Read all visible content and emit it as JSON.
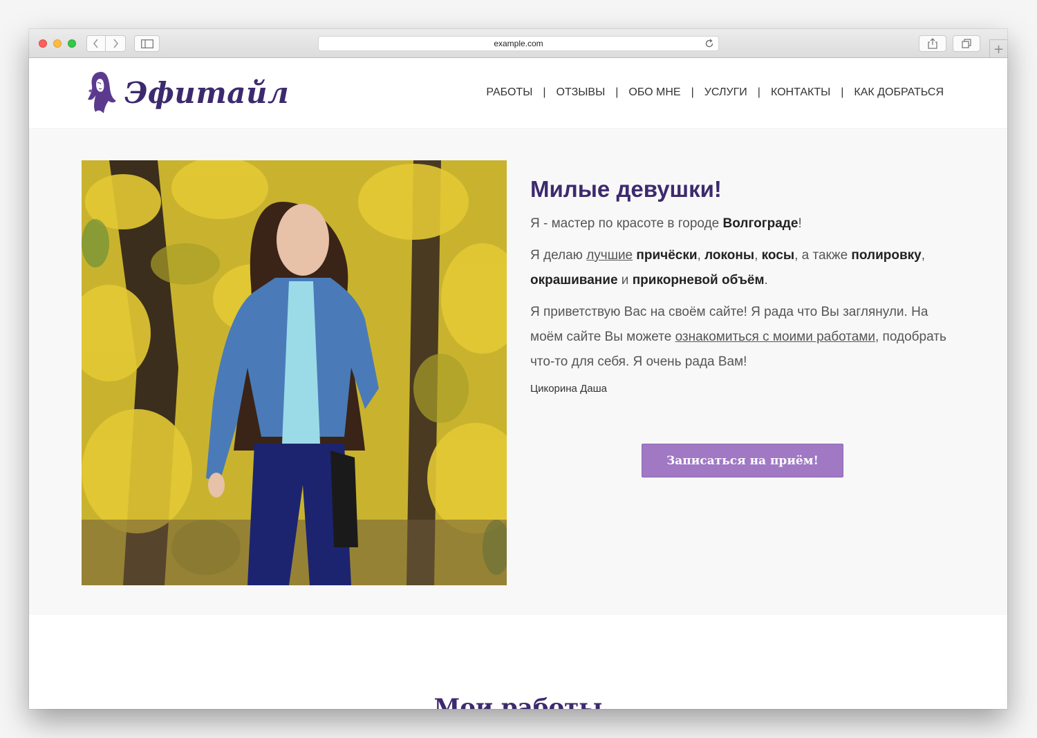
{
  "browser": {
    "url": "example.com",
    "icons": {
      "back": "chevron-left-icon",
      "forward": "chevron-right-icon",
      "sidebar": "sidebar-icon",
      "reload": "reload-icon",
      "share": "share-icon",
      "tabs": "tabs-icon",
      "new_tab": "plus-icon"
    }
  },
  "header": {
    "logo_text": "Эфитайл",
    "nav": [
      {
        "label": "РАБОТЫ"
      },
      {
        "label": "ОТЗЫВЫ"
      },
      {
        "label": "ОБО МНЕ"
      },
      {
        "label": "УСЛУГИ"
      },
      {
        "label": "КОНТАКТЫ"
      },
      {
        "label": "КАК ДОБРАТЬСЯ"
      }
    ],
    "nav_separator": "|"
  },
  "hero": {
    "heading": "Милые девушки!",
    "p1": {
      "t1": "Я - мастер по красоте в городе ",
      "b1": "Волгограде",
      "t2": "!"
    },
    "p2": {
      "t1": "Я делаю ",
      "link": "лучшие",
      "b1": "причёски",
      "t2": ", ",
      "b2": "локоны",
      "t3": ", ",
      "b3": "косы",
      "t4": ", а также ",
      "b4": "полировку",
      "t5": ", ",
      "b5": "окрашивание",
      "t6": " и ",
      "b6": "прикорневой объём",
      "t7": "."
    },
    "p3": {
      "t1": "Я приветствую Вас на своём сайте! Я рада что Вы заглянули. На моём сайте Вы можете ",
      "link": "ознакомиться с моими работами",
      "t2": ", подобрать что-то для себя. Я очень рада Вам!"
    },
    "signature": "Цикорина Даша",
    "cta_label": "Записаться на приём!"
  },
  "works": {
    "title": "Мои работы"
  },
  "colors": {
    "brand": "#3d2a6e",
    "accent": "#a078c4"
  }
}
